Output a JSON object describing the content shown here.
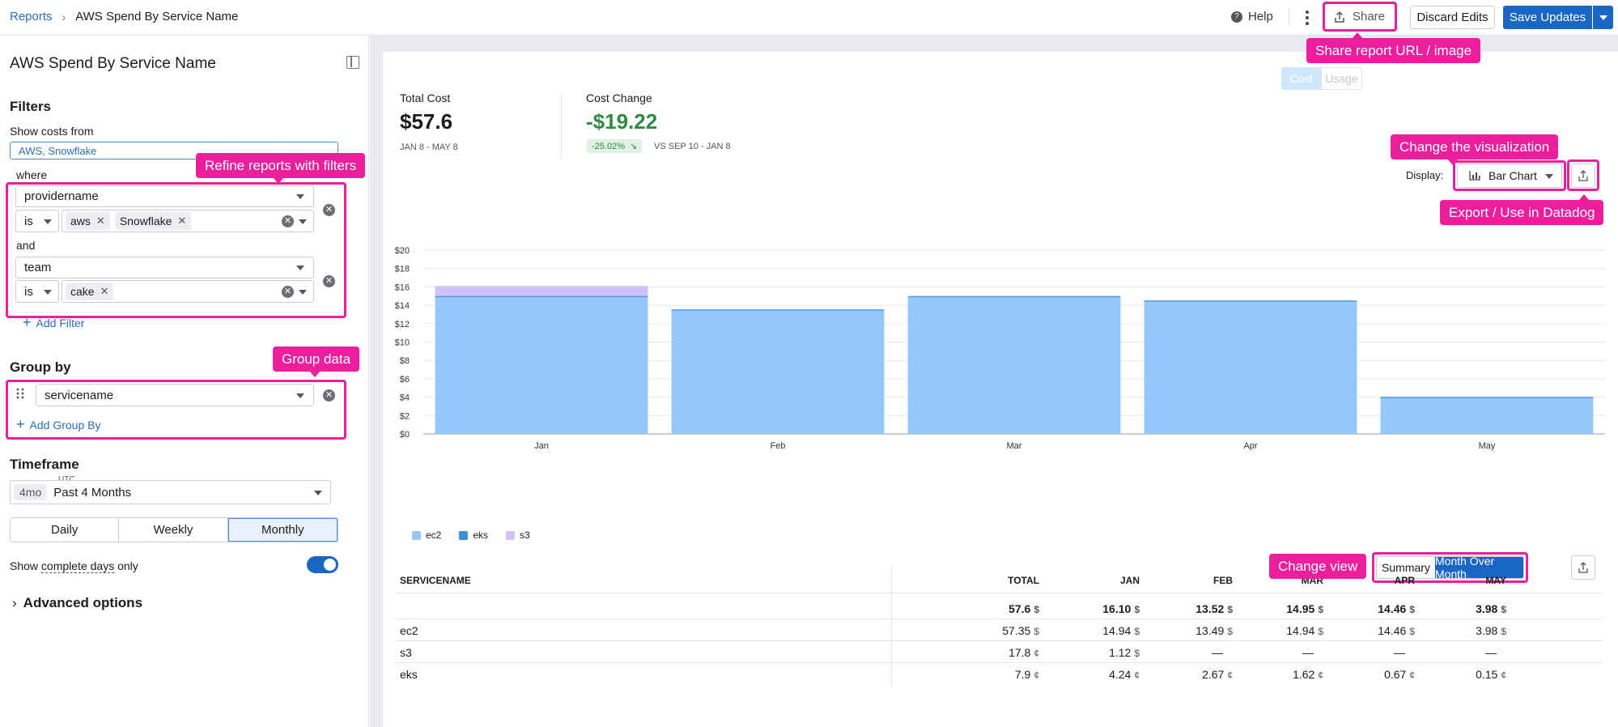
{
  "breadcrumb": {
    "root": "Reports",
    "current": "AWS Spend By Service Name"
  },
  "header": {
    "help": "Help",
    "share": "Share",
    "discard": "Discard Edits",
    "save": "Save Updates"
  },
  "callouts": {
    "share": "Share report URL / image",
    "filters": "Refine reports with filters",
    "group": "Group data",
    "viz": "Change the visualization",
    "export": "Export / Use in Datadog",
    "view": "Change view"
  },
  "sidebar": {
    "title": "AWS Spend By Service Name",
    "filters_title": "Filters",
    "show_costs_label": "Show costs from",
    "show_costs_value": "AWS, Snowflake",
    "where": "where",
    "and": "and",
    "filters": [
      {
        "key": "providername",
        "op": "is",
        "values": [
          "aws",
          "Snowflake"
        ]
      },
      {
        "key": "team",
        "op": "is",
        "values": [
          "cake"
        ]
      }
    ],
    "add_filter": "Add Filter",
    "group_title": "Group by",
    "group_value": "servicename",
    "add_group": "Add Group By",
    "timeframe_title": "Timeframe",
    "tz": "UTC",
    "tf_badge": "4mo",
    "tf_value": "Past 4 Months",
    "granularity": [
      "Daily",
      "Weekly",
      "Monthly"
    ],
    "granularity_selected": "Monthly",
    "complete_days_pre": "Show ",
    "complete_days_u": "complete days",
    "complete_days_post": " only",
    "advanced": "Advanced options"
  },
  "metric_toggle": [
    "Cost",
    "Usage"
  ],
  "summary": {
    "total_label": "Total Cost",
    "total_value": "$57.6",
    "total_range": "JAN 8 - MAY 8",
    "change_label": "Cost Change",
    "change_value": "-$19.22",
    "change_pct": "-25.02%",
    "change_vs": "VS SEP 10 - JAN 8"
  },
  "display": {
    "label": "Display:",
    "value": "Bar Chart"
  },
  "colors": {
    "ec2": "#94c8f8",
    "eks": "#3e8fd8",
    "s3": "#d2c1f7",
    "accent": "#ec1e9c",
    "primary": "#1a66c4"
  },
  "chart_data": {
    "type": "bar",
    "stacked": true,
    "categories": [
      "Jan",
      "Feb",
      "Mar",
      "Apr",
      "May"
    ],
    "series": [
      {
        "name": "ec2",
        "values": [
          14.94,
          13.49,
          14.94,
          14.46,
          3.98
        ]
      },
      {
        "name": "eks",
        "values": [
          0.0424,
          0.0267,
          0.0162,
          0.0067,
          0.0015
        ]
      },
      {
        "name": "s3",
        "values": [
          1.12,
          0,
          0,
          0,
          0
        ]
      }
    ],
    "yticks": [
      "$20",
      "$18",
      "$16",
      "$14",
      "$12",
      "$10",
      "$8",
      "$6",
      "$4",
      "$2",
      "$0"
    ],
    "ylim": [
      0,
      20
    ],
    "legend": "bottom-left"
  },
  "view_toggle": [
    "Summary",
    "Month Over Month"
  ],
  "table": {
    "headers": [
      "SERVICENAME",
      "TOTAL",
      "JAN",
      "FEB",
      "MAR",
      "APR",
      "MAY"
    ],
    "rows": [
      {
        "name": "",
        "cells": [
          [
            "57.6",
            "$"
          ],
          [
            "16.10",
            "$"
          ],
          [
            "13.52",
            "$"
          ],
          [
            "14.95",
            "$"
          ],
          [
            "14.46",
            "$"
          ],
          [
            "3.98",
            "$"
          ]
        ],
        "bold": true
      },
      {
        "name": "ec2",
        "cells": [
          [
            "57.35",
            "$"
          ],
          [
            "14.94",
            "$"
          ],
          [
            "13.49",
            "$"
          ],
          [
            "14.94",
            "$"
          ],
          [
            "14.46",
            "$"
          ],
          [
            "3.98",
            "$"
          ]
        ]
      },
      {
        "name": "s3",
        "cells": [
          [
            "17.8",
            "¢"
          ],
          [
            "1.12",
            "$"
          ],
          [
            "—",
            ""
          ],
          [
            "—",
            ""
          ],
          [
            "—",
            ""
          ],
          [
            "—",
            ""
          ]
        ]
      },
      {
        "name": "eks",
        "cells": [
          [
            "7.9",
            "¢"
          ],
          [
            "4.24",
            "¢"
          ],
          [
            "2.67",
            "¢"
          ],
          [
            "1.62",
            "¢"
          ],
          [
            "0.67",
            "¢"
          ],
          [
            "0.15",
            "¢"
          ]
        ]
      }
    ]
  }
}
